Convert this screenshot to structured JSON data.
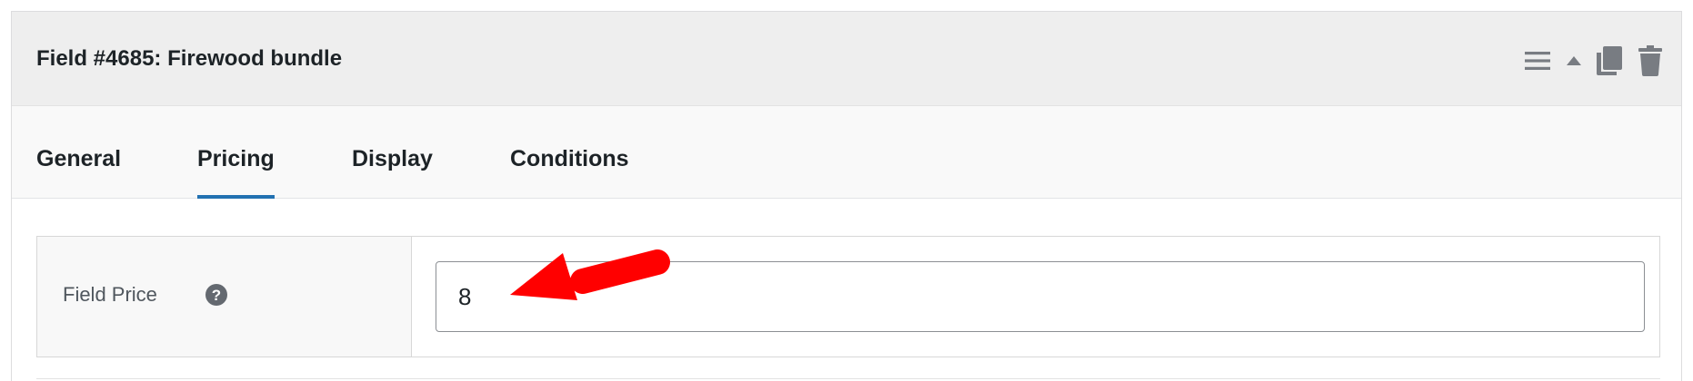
{
  "header": {
    "field_title": "Field #4685: Firewood bundle",
    "actions": [
      {
        "name": "reorder-handle-icon"
      },
      {
        "name": "collapse-toggle-icon"
      },
      {
        "name": "duplicate-icon"
      },
      {
        "name": "delete-trash-icon"
      }
    ]
  },
  "tabs": [
    {
      "label": "General",
      "active": false
    },
    {
      "label": "Pricing",
      "active": true
    },
    {
      "label": "Display",
      "active": false
    },
    {
      "label": "Conditions",
      "active": false
    }
  ],
  "field_price": {
    "label": "Field Price",
    "help_icon": "question-circle-icon",
    "value": "8"
  },
  "annotation": {
    "icon": "red-arrow-annotation",
    "color": "#ff0000"
  },
  "colors": {
    "accent": "#2271b1",
    "header_bg": "#eeeeee",
    "tabs_bg": "#f9f9f9",
    "icon": "#787c82"
  }
}
